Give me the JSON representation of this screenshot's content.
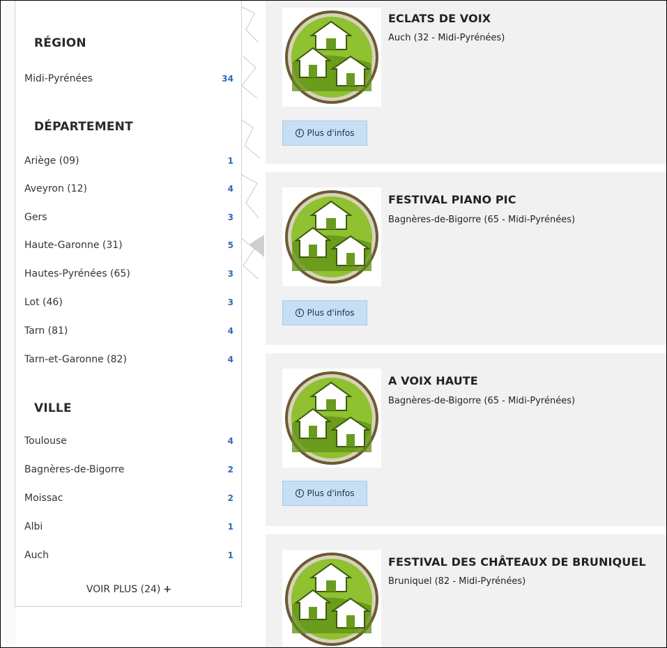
{
  "filters": {
    "region": {
      "title": "RÉGION",
      "items": [
        {
          "label": "Midi-Pyrénées",
          "count": "34"
        }
      ]
    },
    "departement": {
      "title": "DÉPARTEMENT",
      "items": [
        {
          "label": "Ariège (09)",
          "count": "1"
        },
        {
          "label": "Aveyron (12)",
          "count": "4"
        },
        {
          "label": "Gers",
          "count": "3"
        },
        {
          "label": "Haute-Garonne (31)",
          "count": "5"
        },
        {
          "label": "Hautes-Pyrénées (65)",
          "count": "3"
        },
        {
          "label": "Lot (46)",
          "count": "3"
        },
        {
          "label": "Tarn (81)",
          "count": "4"
        },
        {
          "label": "Tarn-et-Garonne (82)",
          "count": "4"
        }
      ]
    },
    "ville": {
      "title": "VILLE",
      "items": [
        {
          "label": "Toulouse",
          "count": "4"
        },
        {
          "label": "Bagnères-de-Bigorre",
          "count": "2"
        },
        {
          "label": "Moissac",
          "count": "2"
        },
        {
          "label": "Albi",
          "count": "1"
        },
        {
          "label": "Auch",
          "count": "1"
        }
      ]
    },
    "voir_plus": "VOIR PLUS (24)",
    "voir_plus_icon": "+"
  },
  "results": [
    {
      "title": "ECLATS DE VOIX",
      "location": "Auch (32 - Midi-Pyrénées)",
      "button": "Plus d'infos"
    },
    {
      "title": "FESTIVAL PIANO PIC",
      "location": "Bagnères-de-Bigorre (65 - Midi-Pyrénées)",
      "button": "Plus d'infos"
    },
    {
      "title": "A VOIX HAUTE",
      "location": "Bagnères-de-Bigorre (65 - Midi-Pyrénées)",
      "button": "Plus d'infos"
    },
    {
      "title": "FESTIVAL DES CHÂTEAUX DE BRUNIQUEL",
      "location": "Bruniquel (82 - Midi-Pyrénées)",
      "button": "Plus d'infos"
    }
  ],
  "icons": {
    "logo": "houses-logo-icon",
    "info": "info-icon",
    "info_glyph": "i"
  },
  "colors": {
    "count_color": "#2a6cb8",
    "button_bg": "#c6dff4",
    "card_bg": "#f1f1f1",
    "logo_green": "#8fc130"
  }
}
